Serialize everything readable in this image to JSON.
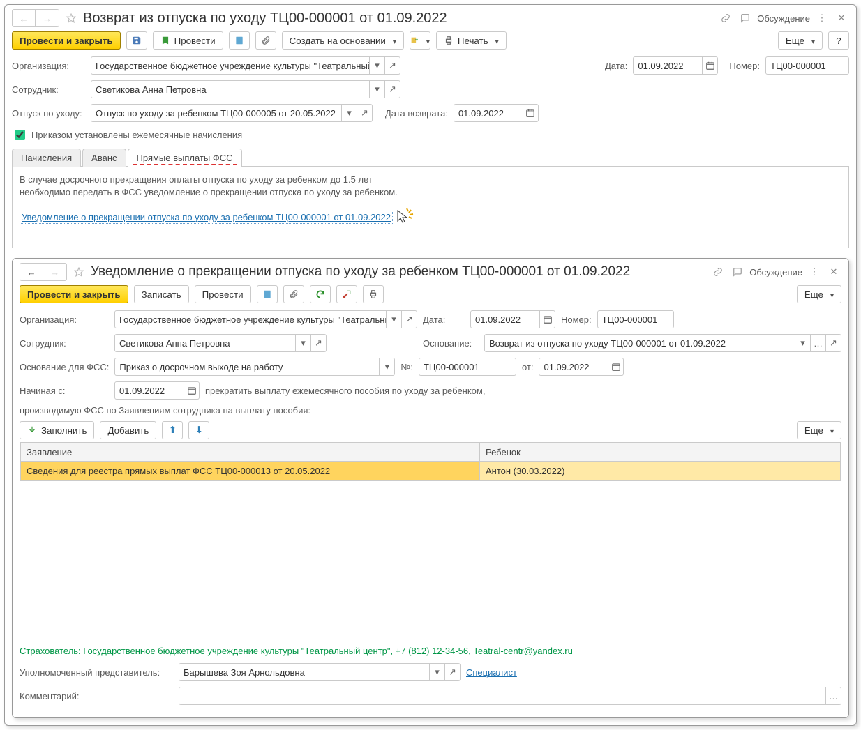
{
  "win1": {
    "title": "Возврат из отпуска по уходу ТЦ00-000001 от 01.09.2022",
    "discussion": "Обсуждение",
    "toolbar": {
      "post_close": "Провести и закрыть",
      "post": "Провести",
      "create_based": "Создать на основании",
      "print": "Печать",
      "more": "Еще"
    },
    "labels": {
      "org": "Организация:",
      "emp": "Сотрудник:",
      "leave": "Отпуск по уходу:",
      "return_date": "Дата возврата:",
      "date": "Дата:",
      "number": "Номер:"
    },
    "values": {
      "org": "Государственное бюджетное учреждение культуры \"Театральный ц",
      "emp": "Светикова Анна Петровна",
      "leave": "Отпуск по уходу за ребенком ТЦ00-000005 от 20.05.2022",
      "return_date": "01.09.2022",
      "date": "01.09.2022",
      "number": "ТЦ00-000001"
    },
    "checkbox": "Приказом установлены ежемесячные начисления",
    "tabs": {
      "t1": "Начисления",
      "t2": "Аванс",
      "t3": "Прямые выплаты ФСС"
    },
    "tabpane": {
      "line1": "В случае досрочного прекращения оплаты отпуска по уходу за ребенком до 1.5 лет",
      "line2": "необходимо передать в ФСС уведомление о прекращении отпуска по уходу за ребенком.",
      "link": "Уведомление о прекращении отпуска по уходу за ребенком ТЦ00-000001 от 01.09.2022"
    }
  },
  "win2": {
    "title": "Уведомление о прекращении отпуска по уходу за ребенком ТЦ00-000001 от 01.09.2022",
    "discussion": "Обсуждение",
    "toolbar": {
      "post_close": "Провести и закрыть",
      "save": "Записать",
      "post": "Провести",
      "more": "Еще"
    },
    "labels": {
      "org": "Организация:",
      "emp": "Сотрудник:",
      "date": "Дата:",
      "number": "Номер:",
      "basis": "Основание:",
      "basis_fss": "Основание для ФСС:",
      "no": "№:",
      "from": "от:",
      "starting": "Начиная с:",
      "stop_text": "прекратить выплату ежемесячного пособия по уходу за ребенком,",
      "produced_text": "производимую ФСС по Заявлениям сотрудника на выплату пособия:",
      "fill": "Заполнить",
      "add": "Добавить",
      "more": "Еще",
      "repr": "Уполномоченный представитель:",
      "comment": "Комментарий:"
    },
    "values": {
      "org": "Государственное бюджетное учреждение культуры \"Театральный",
      "emp": "Светикова Анна Петровна",
      "date": "01.09.2022",
      "number": "ТЦ00-000001",
      "basis": "Возврат из отпуска по уходу ТЦ00-000001 от 01.09.2022",
      "basis_fss": "Приказ о досрочном выходе на работу",
      "no": "ТЦ00-000001",
      "from": "01.09.2022",
      "starting": "01.09.2022",
      "repr": "Барышева Зоя Арнольдовна",
      "repr_link": "Специалист"
    },
    "table": {
      "col1": "Заявление",
      "col2": "Ребенок",
      "row1_c1": "Сведения для реестра прямых выплат ФСС ТЦ00-000013 от 20.05.2022",
      "row1_c2": "Антон (30.03.2022)"
    },
    "insurer_link": "Страхователь: Государственное бюджетное учреждение культуры \"Театральный центр\", +7 (812) 12-34-56, Teatral-centr@yandex.ru"
  }
}
